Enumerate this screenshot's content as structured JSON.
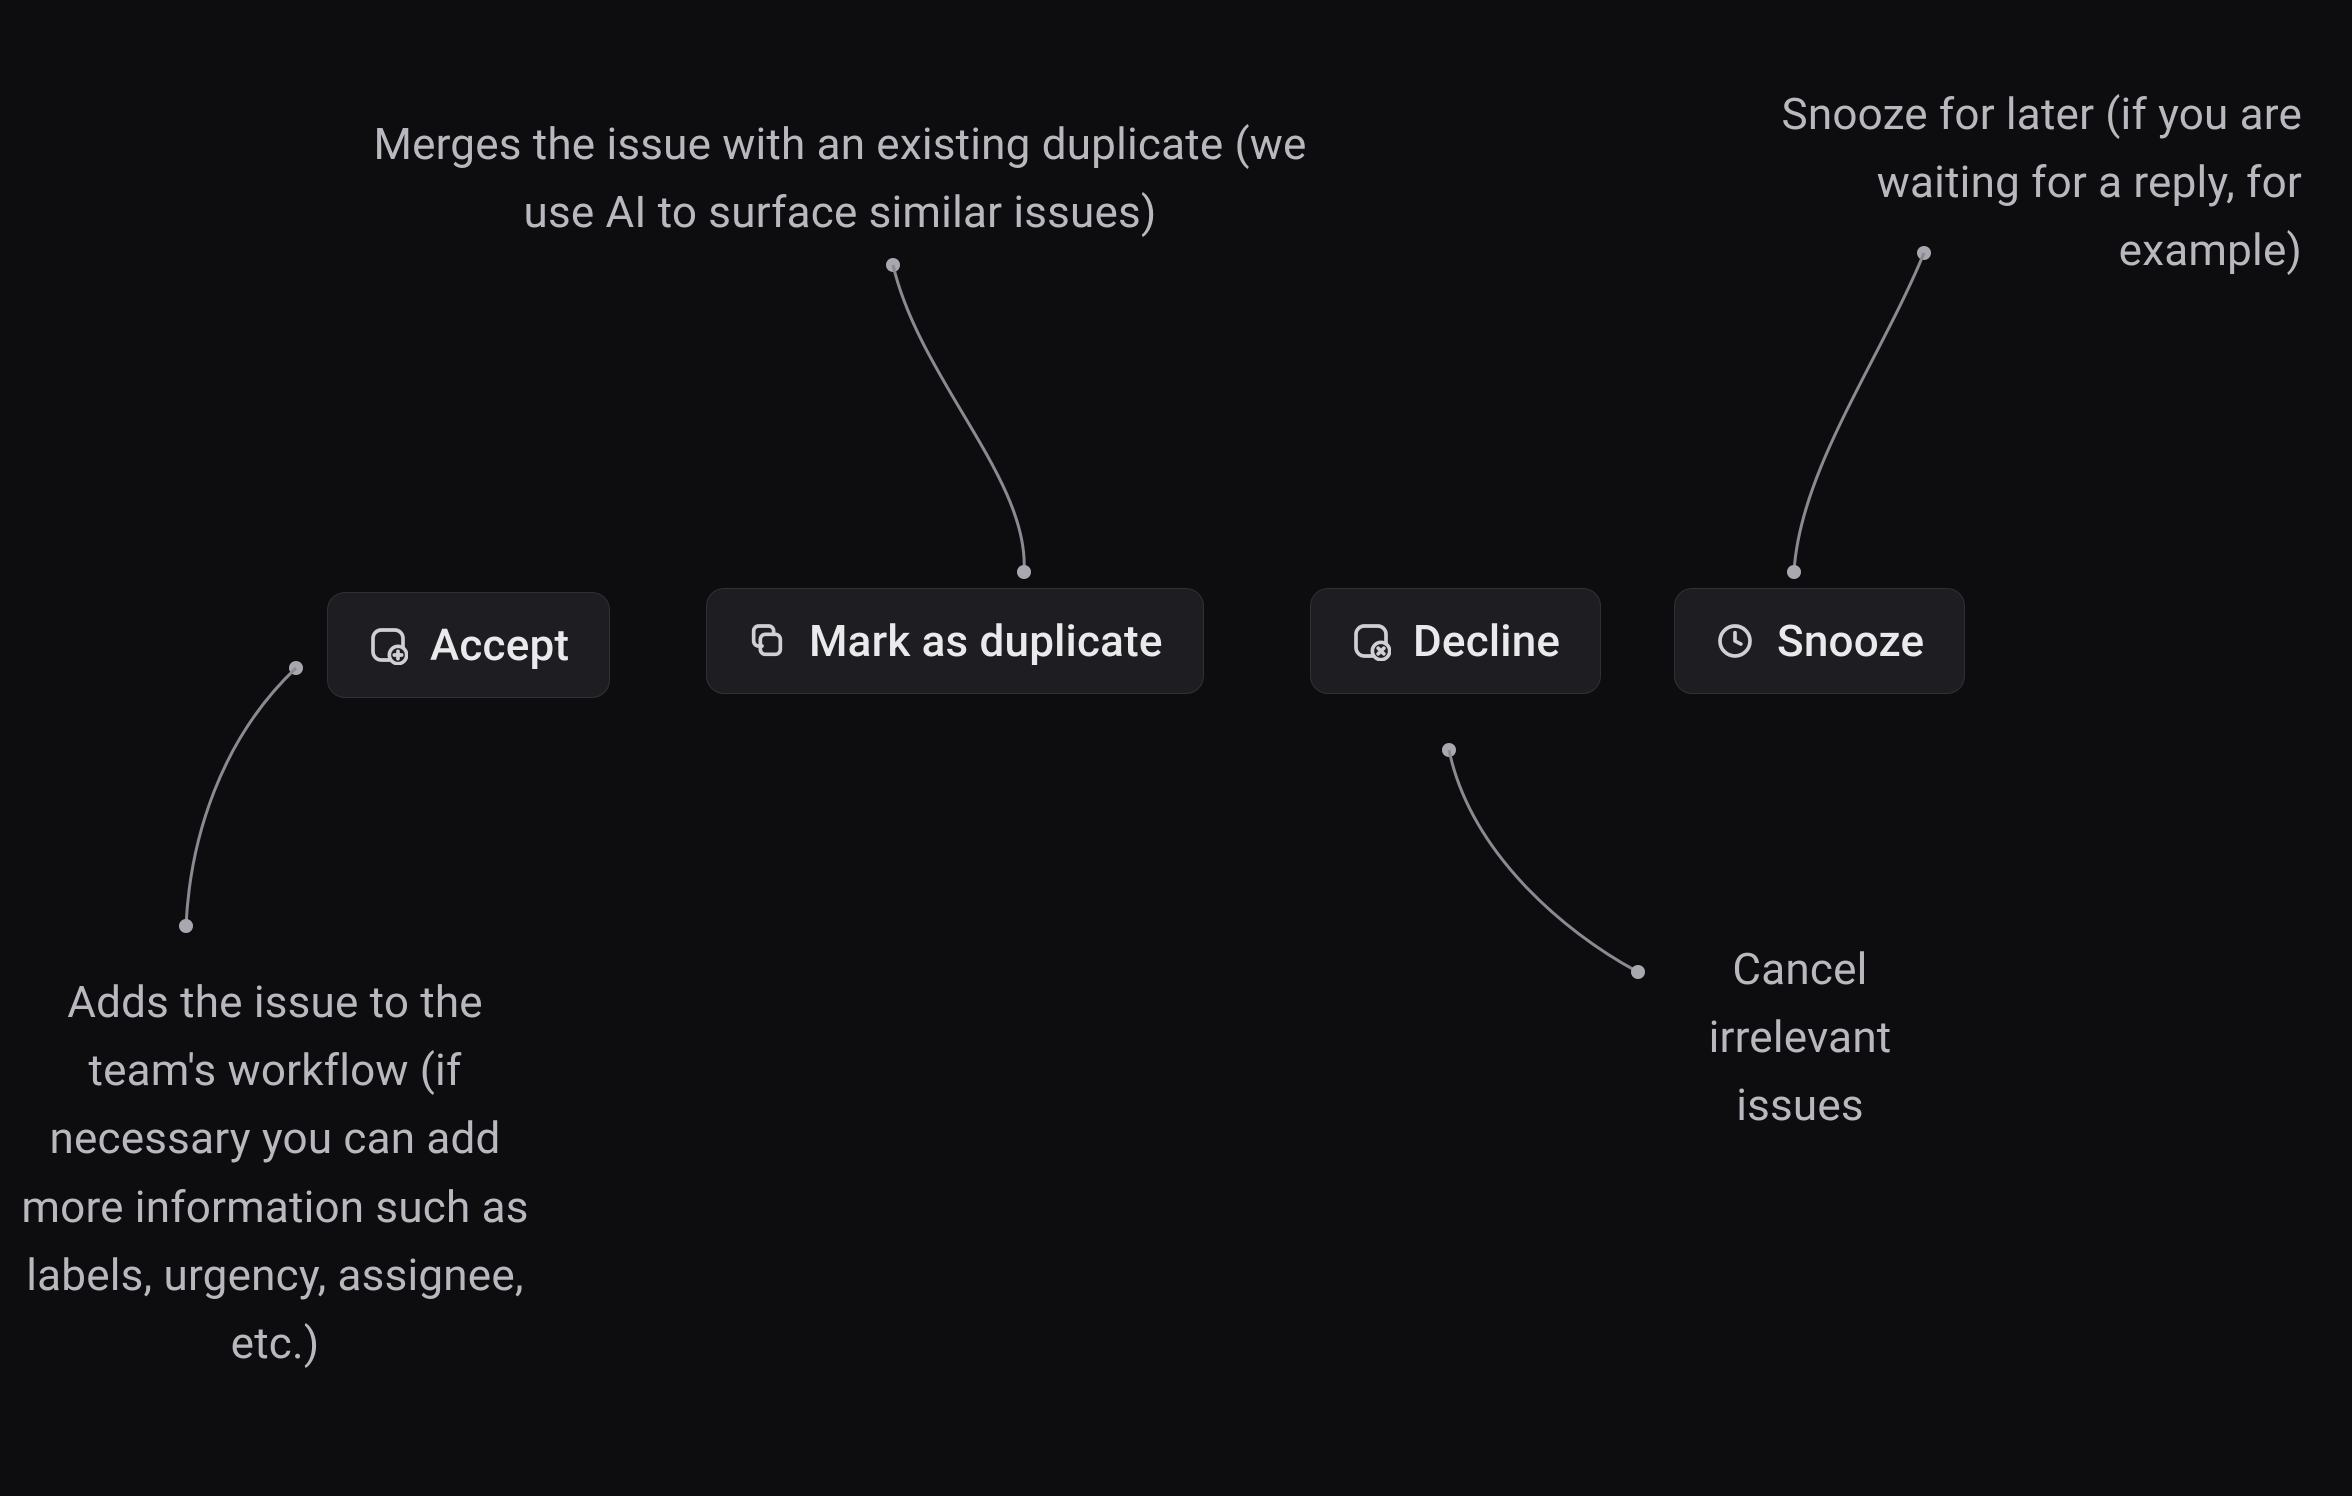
{
  "buttons": {
    "accept": {
      "label": "Accept"
    },
    "duplicate": {
      "label": "Mark as duplicate"
    },
    "decline": {
      "label": "Decline"
    },
    "snooze": {
      "label": "Snooze"
    }
  },
  "annotations": {
    "accept": "Adds the issue to the team's workflow\n(if necessary you can add more information such as labels, urgency, assignee, etc.)",
    "duplicate": "Merges the issue with an existing duplicate (we use AI to surface similar issues)",
    "decline": "Cancel irrelevant issues",
    "snooze": "Snooze for later (if you are waiting for a reply, for example)"
  }
}
